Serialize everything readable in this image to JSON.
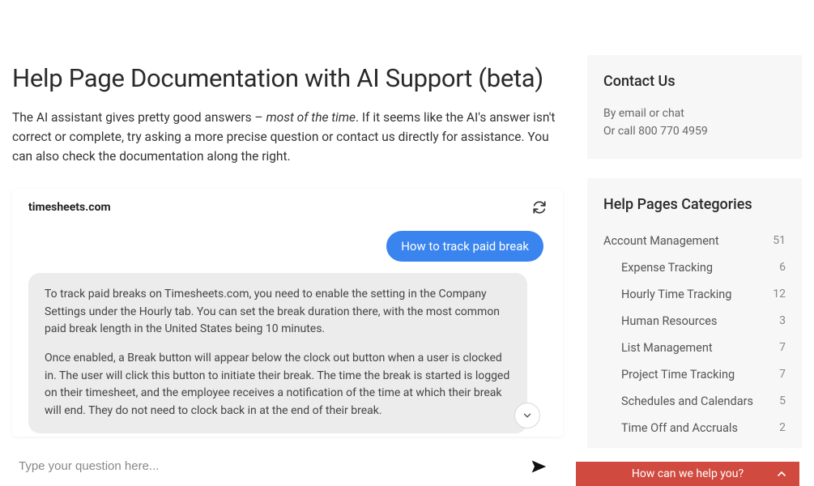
{
  "main": {
    "title": "Help Page Documentation with AI Support (beta)",
    "intro_before": "The AI assistant gives pretty good answers – ",
    "intro_em": "most of the time",
    "intro_after": ". If it seems like the AI's answer isn't correct or complete, try asking a more precise question or contact us directly for assistance. You can also check the documentation along the right."
  },
  "chat": {
    "title": "timesheets.com",
    "user_message": "How to track paid break",
    "ai_p1": "To track paid breaks on Timesheets.com, you need to enable the setting in the Company Settings under the Hourly tab. You can set the break duration there, with the most common paid break length in the United States being 10 minutes.",
    "ai_p2": "Once enabled, a Break button will appear below the clock out button when a user is clocked in. The user will click this button to initiate their break. The time the break is started is logged on their timesheet, and the employee receives a notification of the time at which their break will end. They do not need to clock back in at the end of their break.",
    "input_placeholder": "Type your question here..."
  },
  "contact": {
    "heading": "Contact Us",
    "line1": "By email or chat",
    "line2": "Or call 800 770 4959"
  },
  "categories": {
    "heading": "Help Pages Categories",
    "items": [
      {
        "label": "Account Management",
        "count": "51",
        "sub": false
      },
      {
        "label": "Expense Tracking",
        "count": "6",
        "sub": true
      },
      {
        "label": "Hourly Time Tracking",
        "count": "12",
        "sub": true
      },
      {
        "label": "Human Resources",
        "count": "3",
        "sub": true
      },
      {
        "label": "List Management",
        "count": "7",
        "sub": true
      },
      {
        "label": "Project Time Tracking",
        "count": "7",
        "sub": true
      },
      {
        "label": "Schedules and Calendars",
        "count": "5",
        "sub": true
      },
      {
        "label": "Time Off and Accruals",
        "count": "2",
        "sub": true
      }
    ]
  },
  "helpbar": {
    "label": "How can we help you?"
  }
}
